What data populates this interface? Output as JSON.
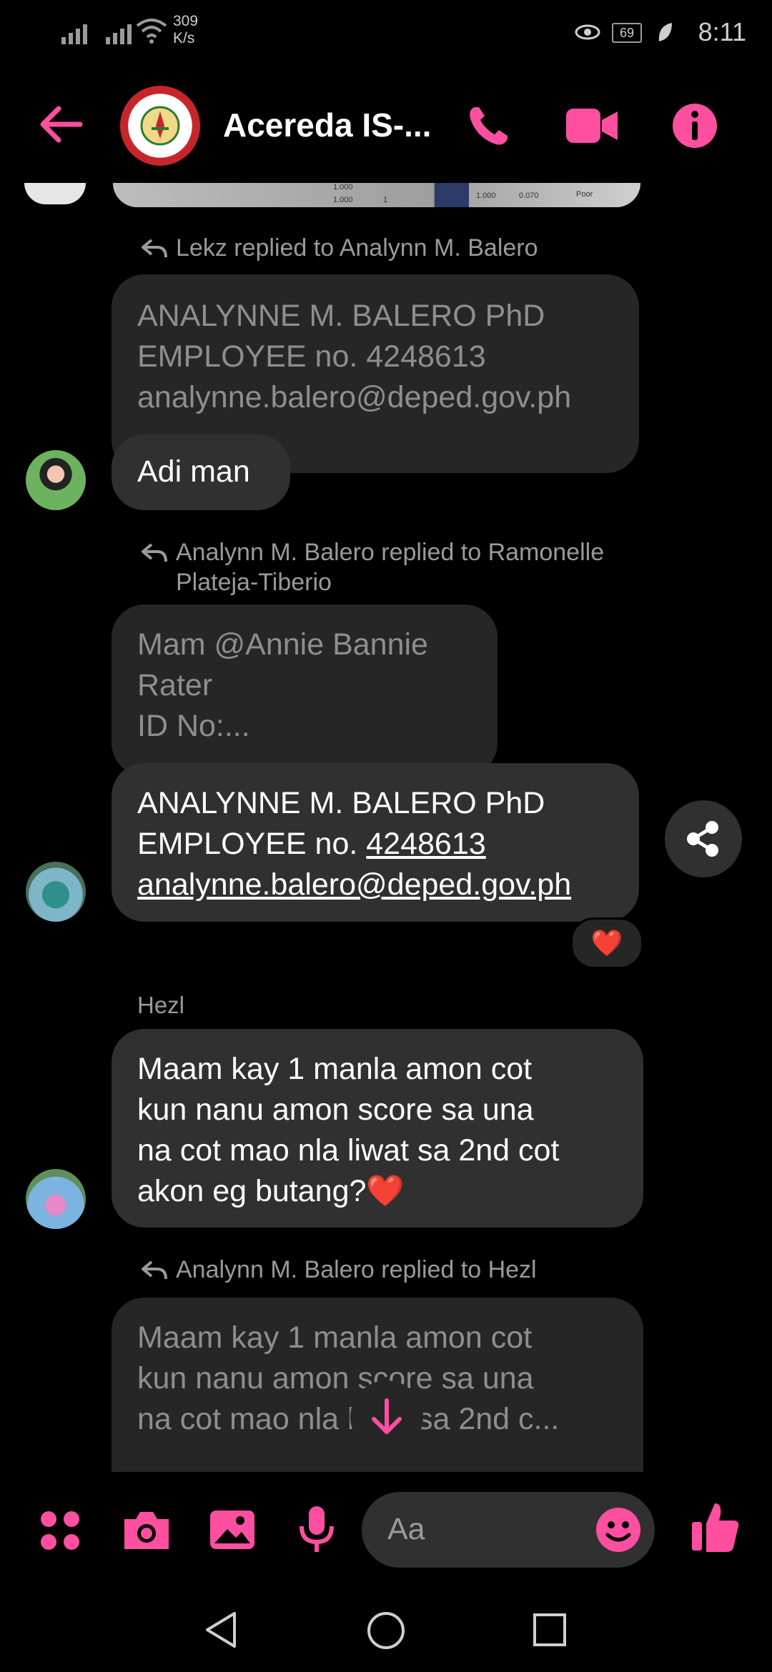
{
  "status_bar": {
    "speed_value": "309",
    "speed_unit": "K/s",
    "battery": "69",
    "time": "8:11"
  },
  "header": {
    "title": "Acereda IS-..."
  },
  "messages": {
    "reply1_note": "Lekz replied to Analynn M. Balero",
    "quoted1": [
      "ANALYNNE M. BALERO PhD",
      "EMPLOYEE no. 4248613",
      "analynne.balero@deped.gov.ph"
    ],
    "msg1": "Adi man",
    "reply2_note_line1": "Analynn M. Balero replied to Ramonelle",
    "reply2_note_line2": "Plateja-Tiberio",
    "quoted2": [
      "Mam @Annie Bannie",
      "Rater",
      "ID No:..."
    ],
    "msg2": {
      "line1": "ANALYNNE M. BALERO PhD",
      "line2_prefix": "EMPLOYEE no. ",
      "line2_link": "4248613",
      "line3_link": "analynne.balero@deped.gov.ph"
    },
    "reaction": "❤️",
    "sender_hezl": "Hezl",
    "msg3": [
      "Maam kay 1 manla amon cot",
      "kun nanu amon score sa una",
      "na cot mao nla liwat sa 2nd cot",
      "akon eg butang?❤️"
    ],
    "reply3_note": "Analynn M. Balero replied to Hezl",
    "quoted3": [
      "Maam kay 1 manla amon cot",
      "kun nanu amon score sa una",
      "na cot mao nla liwat sa 2nd c..."
    ],
    "chart_snippet": {
      "v1": "1.000",
      "v2": "1.000",
      "v3": "1",
      "v4": "1.000",
      "v5": "0.070",
      "v6": "Poor"
    }
  },
  "composer": {
    "placeholder": "Aa"
  },
  "colors": {
    "accent": "#ff4fa0",
    "bubble": "#303030",
    "quoted_bubble": "#262626"
  }
}
